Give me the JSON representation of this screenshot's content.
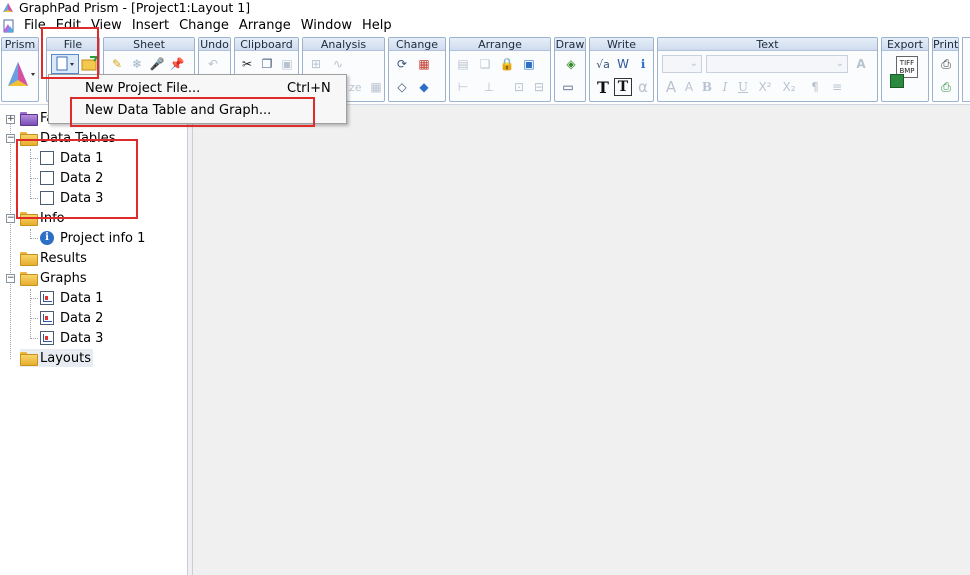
{
  "window": {
    "title": "GraphPad Prism - [Project1:Layout 1]"
  },
  "menubar": {
    "items": [
      "File",
      "Edit",
      "View",
      "Insert",
      "Change",
      "Arrange",
      "Window",
      "Help"
    ]
  },
  "ribbon": {
    "groups": [
      "Prism",
      "File",
      "Sheet",
      "Undo",
      "Clipboard",
      "Analysis",
      "Change",
      "Arrange",
      "Draw",
      "Write",
      "Text",
      "Export",
      "Print"
    ],
    "analysis_partial_label": "ze",
    "write_text_glyph": "T",
    "write_alpha_glyph": "α",
    "text_format_glyphs": [
      "A",
      "A",
      "B",
      "I",
      "U",
      "X²",
      "X₂"
    ],
    "tiff_bmp_label": "TIFF BMP"
  },
  "dropdown": {
    "items": [
      {
        "label": "New Project File...",
        "shortcut": "Ctrl+N"
      },
      {
        "label": "New Data Table and Graph...",
        "shortcut": ""
      }
    ]
  },
  "navigator": {
    "family_label": "Fa",
    "data_tables": {
      "label": "Data Tables",
      "items": [
        "Data 1",
        "Data 2",
        "Data 3"
      ]
    },
    "info": {
      "label": "Info",
      "items": [
        "Project info 1"
      ]
    },
    "results": {
      "label": "Results"
    },
    "graphs": {
      "label": "Graphs",
      "items": [
        "Data 1",
        "Data 2",
        "Data 3"
      ]
    },
    "layouts": {
      "label": "Layouts"
    }
  },
  "colors": {
    "highlight": "#e02b2b",
    "ribbon_border": "#9db2cf",
    "workspace": "#f0f0f0"
  }
}
